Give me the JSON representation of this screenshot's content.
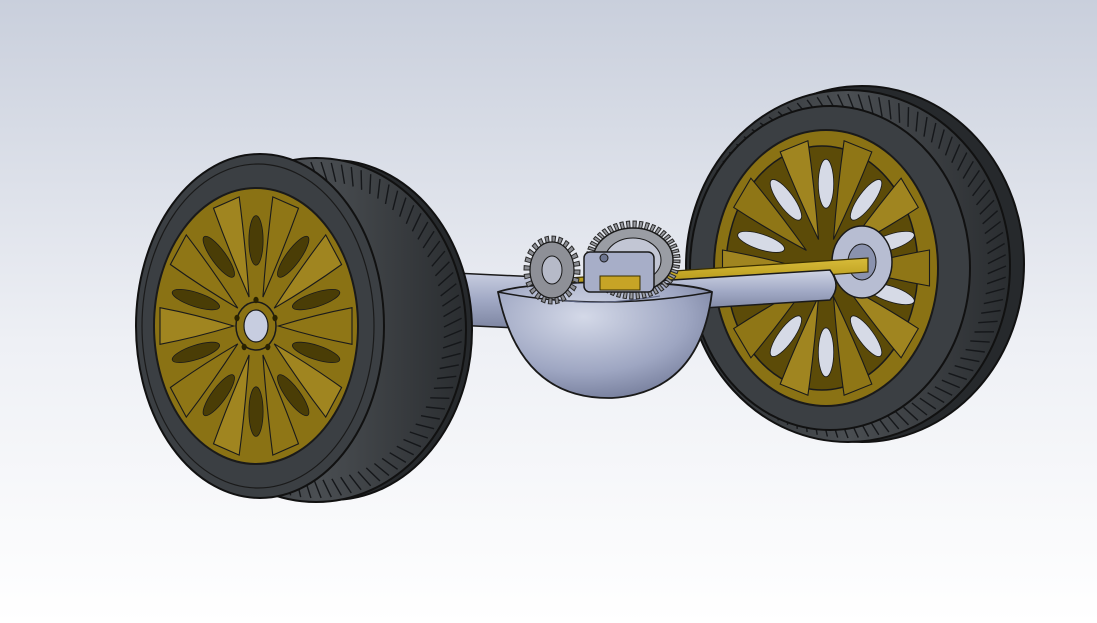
{
  "scene": {
    "subject": "cad-rear-axle-assembly",
    "colors": {
      "background_top": "#c9cfdc",
      "background_bottom": "#ffffff",
      "tire": "#3a3d40",
      "tire_dark": "#24272a",
      "tire_edge": "#141618",
      "rim_gold": "#8a7214",
      "rim_gold_dark": "#5a4a08",
      "rim_gold_light": "#a88d22",
      "axle_shaft": "#b39618",
      "housing": "#9ea6c2",
      "housing_dark": "#737b99",
      "housing_light": "#c7cde0",
      "gear": "#8d8f95",
      "outline": "#1a1a1a"
    }
  }
}
